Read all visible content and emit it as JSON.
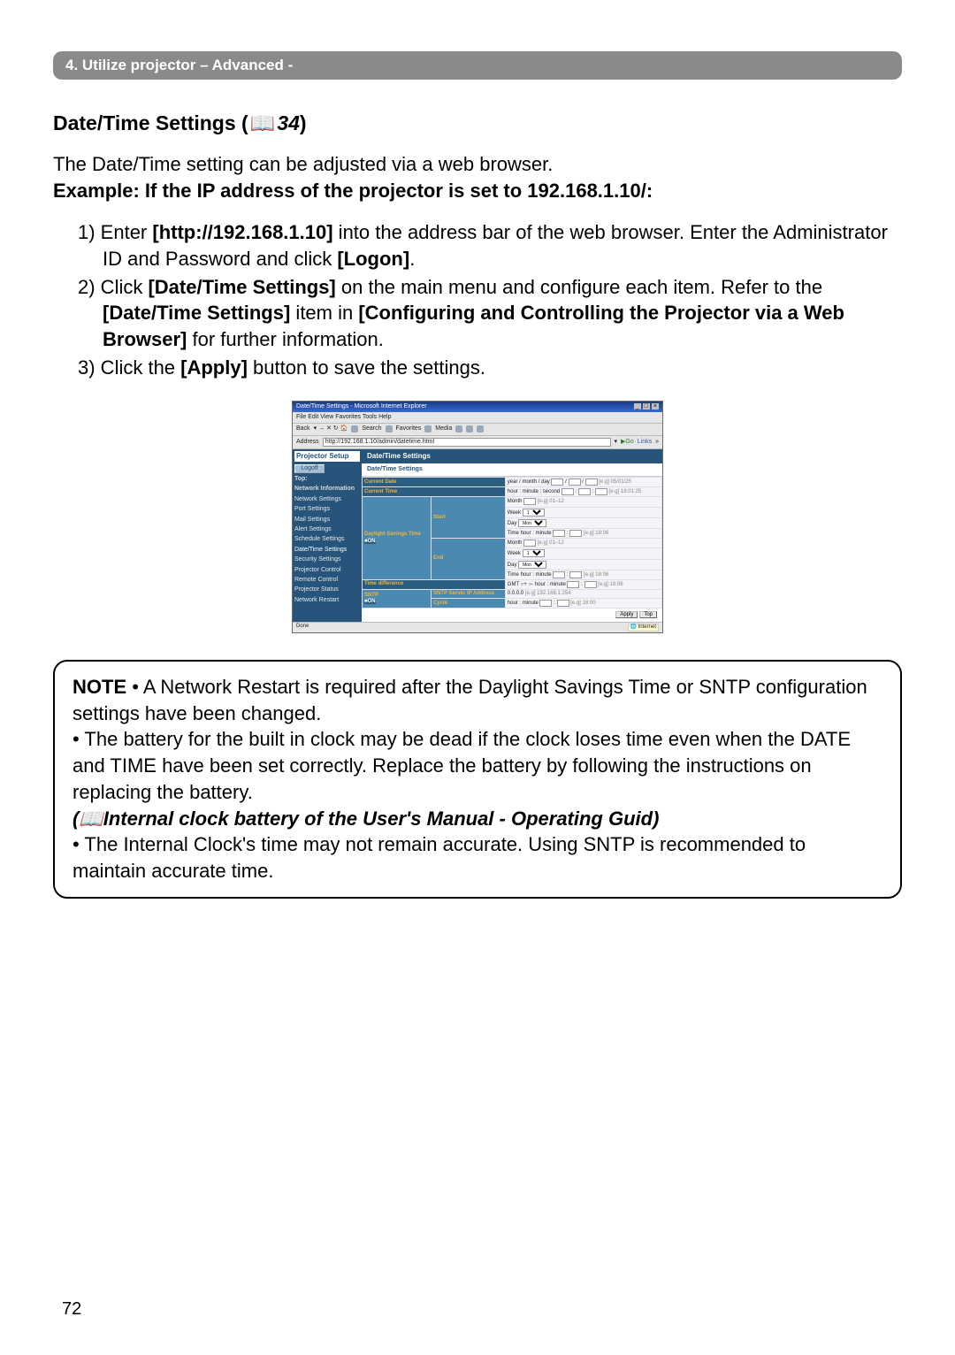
{
  "header": {
    "text": "4. Utilize projector – Advanced -"
  },
  "section": {
    "title_prefix": "Date/Time Settings (",
    "ref": "34",
    "title_suffix": ")"
  },
  "intro": {
    "line1": "The Date/Time setting can be adjusted via a web browser.",
    "line2": "Example: If the IP address of the projector is set to 192.168.1.10/:"
  },
  "steps": [
    {
      "n": "1)",
      "a": " Enter ",
      "b": "[http://192.168.1.10]",
      "c": " into the address bar of the web browser. Enter the Administrator ID and Password and click ",
      "d": "[Logon]",
      "e": "."
    },
    {
      "n": "2)",
      "a": " Click ",
      "b": "[Date/Time Settings]",
      "c": " on the main menu and configure each item. Refer to the ",
      "d": "[Date/Time Settings]",
      "e": " item in ",
      "f": "[Configuring and Controlling the Projector via a Web Browser]",
      "g": " for further information."
    },
    {
      "n": "3)",
      "a": " Click the ",
      "b": "[Apply]",
      "c": " button to save the settings."
    }
  ],
  "browser": {
    "window_title": "Date/Time Settings - Microsoft Internet Explorer",
    "menubar": "File   Edit   View   Favorites   Tools   Help",
    "toolbar": {
      "back": "Back",
      "search": "Search",
      "favorites": "Favorites",
      "media": "Media"
    },
    "address_label": "Address",
    "address_value": "http://192.168.1.10/admin/datetime.html",
    "go": "Go",
    "links": "Links",
    "setup_title": "Projector Setup",
    "logoff": "Logoff",
    "sidebar": {
      "top": "Top:",
      "network_info": "Network Information",
      "items": [
        "Network Settings",
        "Port Settings",
        "Mail Settings",
        "Alert Settings",
        "Schedule Settings",
        "Date/Time Settings",
        "Security Settings",
        "Projector Control",
        "Remote Control",
        "Projector Status",
        "Network Restart"
      ]
    },
    "page_title": "Date/Time Settings",
    "subhead": "Date/Time Settings",
    "rows": {
      "current_date": "Current Date",
      "current_date_labels": "year / month / day",
      "current_date_eg": "[e.g] 05/01/25",
      "current_time": "Current Time",
      "current_time_labels": "hour : minute : second",
      "current_time_eg": "[e.g] 18:01:25",
      "dst": "Daylight Savings Time",
      "on1": "■ON",
      "start": "Start",
      "end": "End",
      "month": "Month",
      "month_eg": "[e.g] 01–12",
      "week": "Week",
      "day": "Day",
      "time": "Time",
      "time_labels": "hour : minute",
      "time_eg": "[e.g] 18:06",
      "time_diff": "Time difference",
      "gmt": "GMT",
      "gmt_eg": "[e.g] 18:06",
      "sntp": "SNTP",
      "on2": "■ON",
      "sntp_server": "SNTP Server IP Address",
      "sntp_ip": "0.0.0.0",
      "sntp_eg": "[e.g] 192.168.1.254",
      "cycle": "Cycle",
      "cycle_labels": "hour : minute",
      "cycle_eg": "[e.g] 18:00"
    },
    "apply": "Apply",
    "top_btn": "Top",
    "status_left": "Done",
    "status_right": "Internet"
  },
  "note": {
    "label": "NOTE",
    "p1": "  • A Network Restart is required after the Daylight Savings Time or SNTP configuration settings have been changed.",
    "p2": "• The battery for the built in clock may be dead if the clock loses time even when the DATE and TIME have been set correctly. Replace the battery by following the instructions on replacing the battery.",
    "ref_open": "(",
    "ref_text": "Internal clock battery of the User's Manual - Operating Guid",
    "ref_close": ")",
    "p3": "• The Internal Clock's time may not remain accurate. Using SNTP is recommended to maintain accurate time."
  },
  "page_number": "72"
}
